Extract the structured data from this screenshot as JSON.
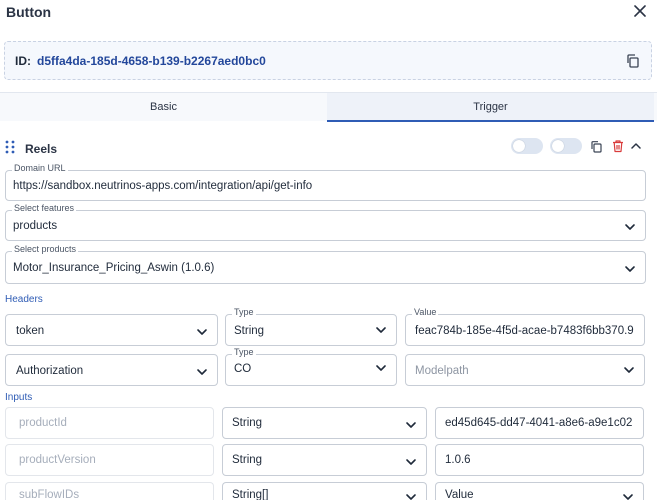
{
  "window": {
    "title": "Button",
    "close_icon": "close-icon"
  },
  "id_box": {
    "label": "ID:",
    "value": "d5ffa4da-185d-4658-b139-b2267aed0bc0",
    "copy_icon": "copy-icon"
  },
  "tabs": [
    {
      "label": "Basic",
      "active": false
    },
    {
      "label": "Trigger",
      "active": true
    }
  ],
  "section": {
    "title": "Reels",
    "toggle1_on": false,
    "toggle2_on": false
  },
  "form": {
    "domain_url": {
      "label": "Domain URL",
      "value": "https://sandbox.neutrinos-apps.com/integration/api/get-info"
    },
    "features": {
      "label": "Select features",
      "value": "products"
    },
    "products": {
      "label": "Select products",
      "value": "Motor_Insurance_Pricing_Aswin (1.0.6)"
    }
  },
  "headers": {
    "title": "Headers",
    "rows": [
      {
        "key": "token",
        "type_label": "Type",
        "type": "String",
        "value_label": "Value",
        "value": "feac784b-185e-4f5d-acae-b7483f6bb370.9"
      },
      {
        "key": "Authorization",
        "type_label": "Type",
        "type": "CO",
        "value_placeholder": "Modelpath"
      }
    ]
  },
  "inputs": {
    "title": "Inputs",
    "rows": [
      {
        "name": "productId",
        "type": "String",
        "value": "ed45d645-dd47-4041-a8e6-a9e1c02"
      },
      {
        "name": "productVersion",
        "type": "String",
        "value": "1.0.6"
      },
      {
        "name": "subFlowIDs",
        "type": "String[]",
        "value": "Value"
      }
    ]
  },
  "colors": {
    "accent": "#2f5cb5",
    "id_text": "#23479b",
    "delete": "#d93b3b"
  }
}
